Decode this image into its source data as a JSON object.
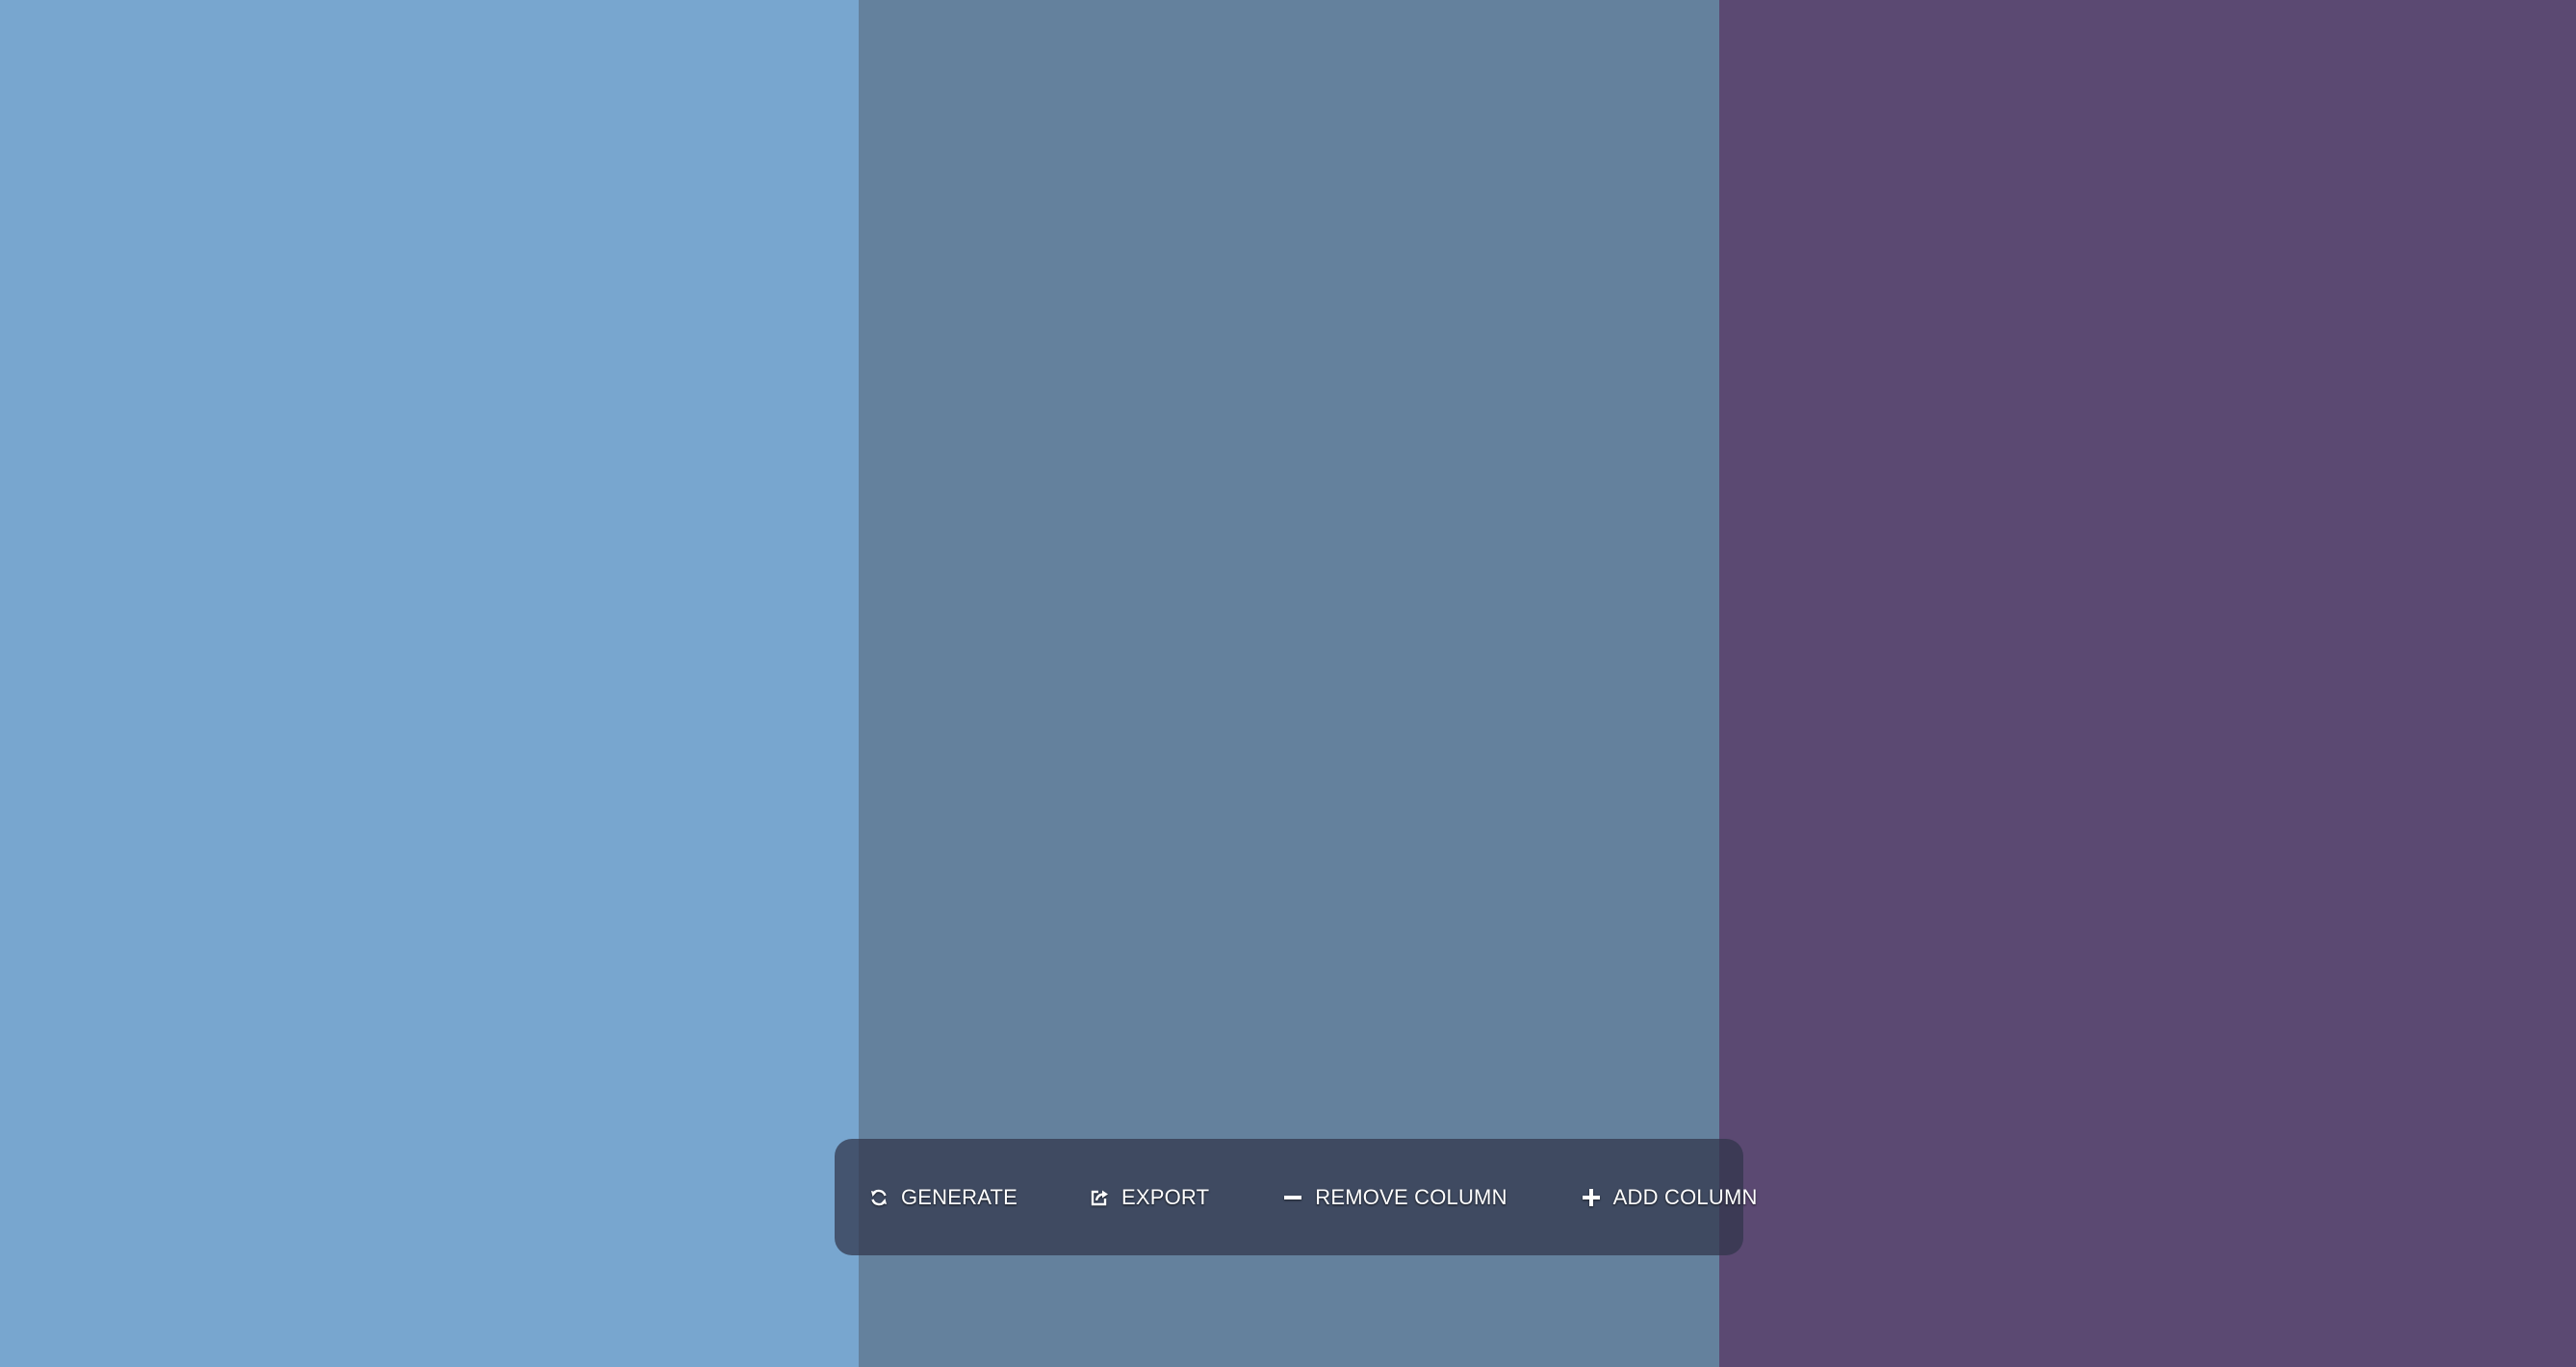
{
  "palette": {
    "colors": [
      "#78a6cf",
      "#64819d",
      "#5b4972"
    ]
  },
  "toolbar": {
    "generate": {
      "label": "GENERATE",
      "icon": "refresh-icon"
    },
    "export": {
      "label": "EXPORT",
      "icon": "share-icon"
    },
    "remove_column": {
      "label": "REMOVE COLUMN",
      "icon": "minus-icon"
    },
    "add_column": {
      "label": "ADD COLUMN",
      "icon": "plus-icon"
    }
  }
}
